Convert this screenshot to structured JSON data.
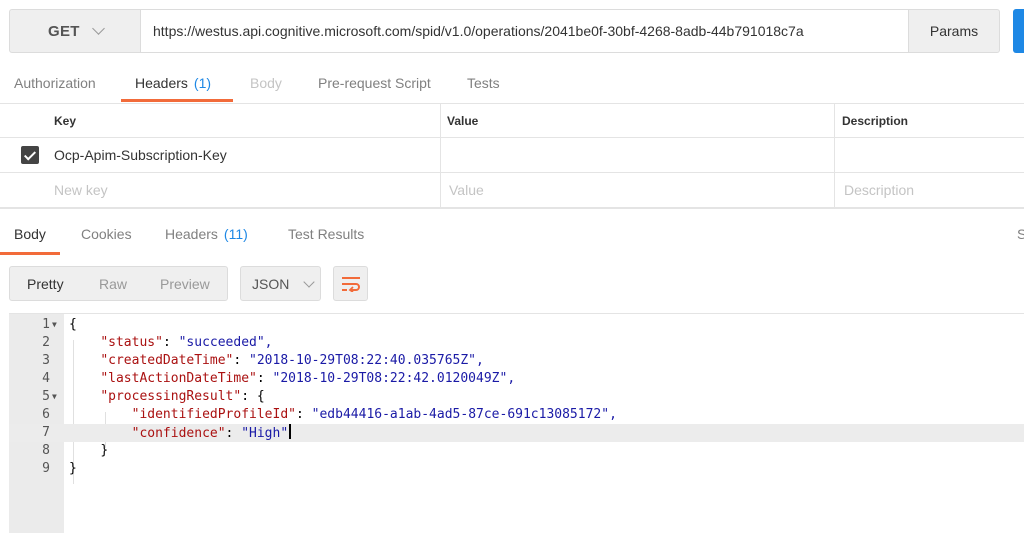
{
  "request": {
    "method": "GET",
    "url": "https://westus.api.cognitive.microsoft.com/spid/v1.0/operations/2041be0f-30bf-4268-8adb-44b791018c7a",
    "params_label": "Params"
  },
  "request_tabs": [
    {
      "label": "Authorization"
    },
    {
      "label": "Headers",
      "count": "(1)"
    },
    {
      "label": "Body"
    },
    {
      "label": "Pre-request Script"
    },
    {
      "label": "Tests"
    }
  ],
  "headers_table": {
    "columns": [
      "Key",
      "Value",
      "Description"
    ],
    "rows": [
      {
        "key": "Ocp-Apim-Subscription-Key",
        "value": "",
        "description": "",
        "checked": true
      }
    ],
    "placeholders": {
      "key": "New key",
      "value": "Value",
      "description": "Description"
    }
  },
  "response_tabs": [
    {
      "label": "Body"
    },
    {
      "label": "Cookies"
    },
    {
      "label": "Headers",
      "count": "(11)"
    },
    {
      "label": "Test Results"
    }
  ],
  "response_tabs_cut_text": "S",
  "view_modes": [
    "Pretty",
    "Raw",
    "Preview"
  ],
  "format": "JSON",
  "code_lines": [
    {
      "n": "1",
      "text": "{"
    },
    {
      "n": "2",
      "key": "\"status\"",
      "val": "\"succeeded\","
    },
    {
      "n": "3",
      "key": "\"createdDateTime\"",
      "val": "\"2018-10-29T08:22:40.035765Z\","
    },
    {
      "n": "4",
      "key": "\"lastActionDateTime\"",
      "val": "\"2018-10-29T08:22:42.0120049Z\","
    },
    {
      "n": "5",
      "key": "\"processingResult\"",
      "val": "{"
    },
    {
      "n": "6",
      "key": "\"identifiedProfileId\"",
      "val": "\"edb44416-a1ab-4ad5-87ce-691c13085172\","
    },
    {
      "n": "7",
      "key": "\"confidence\"",
      "val": "\"High\""
    },
    {
      "n": "8",
      "text": "}"
    },
    {
      "n": "9",
      "text": "}"
    }
  ],
  "colors": {
    "accent": "#f26b3a",
    "link": "#1e88e5",
    "json_key": "#a11111",
    "json_string": "#1a1aa6"
  },
  "icons": {
    "method_dropdown": "chevron-down-icon",
    "format_dropdown": "chevron-down-icon",
    "wrap": "wrap-lines-icon",
    "checkbox": "checkmark-icon"
  }
}
